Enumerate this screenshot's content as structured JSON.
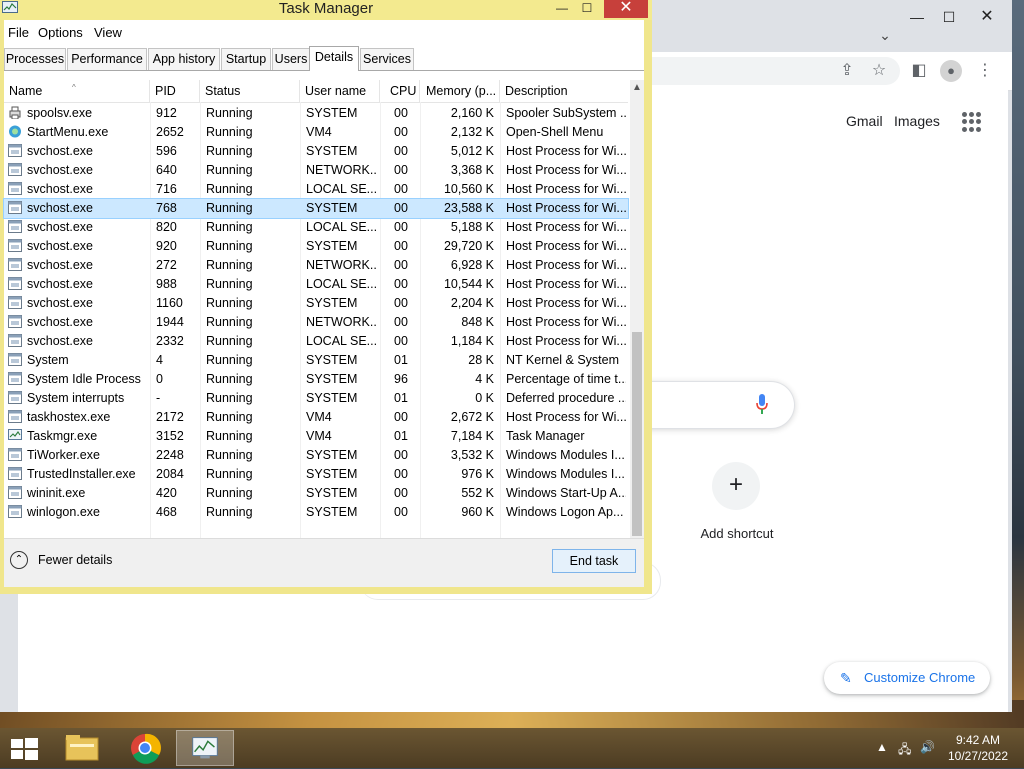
{
  "taskmanager": {
    "title": "Task Manager",
    "menu": [
      "File",
      "Options",
      "View"
    ],
    "tabs": [
      "Processes",
      "Performance",
      "App history",
      "Startup",
      "Users",
      "Details",
      "Services"
    ],
    "active_tab": "Details",
    "columns": [
      "Name",
      "PID",
      "Status",
      "User name",
      "CPU",
      "Memory (p...",
      "Description"
    ],
    "rows": [
      {
        "name": "spoolsv.exe",
        "pid": "912",
        "status": "Running",
        "user": "SYSTEM",
        "cpu": "00",
        "mem": "2,160 K",
        "desc": "Spooler SubSystem ...",
        "icon": "printer-icon"
      },
      {
        "name": "StartMenu.exe",
        "pid": "2652",
        "status": "Running",
        "user": "VM4",
        "cpu": "00",
        "mem": "2,132 K",
        "desc": "Open-Shell Menu",
        "icon": "shell-icon"
      },
      {
        "name": "svchost.exe",
        "pid": "596",
        "status": "Running",
        "user": "SYSTEM",
        "cpu": "00",
        "mem": "5,012 K",
        "desc": "Host Process for Wi...",
        "icon": "process-icon"
      },
      {
        "name": "svchost.exe",
        "pid": "640",
        "status": "Running",
        "user": "NETWORK...",
        "cpu": "00",
        "mem": "3,368 K",
        "desc": "Host Process for Wi...",
        "icon": "process-icon"
      },
      {
        "name": "svchost.exe",
        "pid": "716",
        "status": "Running",
        "user": "LOCAL SE...",
        "cpu": "00",
        "mem": "10,560 K",
        "desc": "Host Process for Wi...",
        "icon": "process-icon"
      },
      {
        "name": "svchost.exe",
        "pid": "768",
        "status": "Running",
        "user": "SYSTEM",
        "cpu": "00",
        "mem": "23,588 K",
        "desc": "Host Process for Wi...",
        "icon": "process-icon",
        "selected": true
      },
      {
        "name": "svchost.exe",
        "pid": "820",
        "status": "Running",
        "user": "LOCAL SE...",
        "cpu": "00",
        "mem": "5,188 K",
        "desc": "Host Process for Wi...",
        "icon": "process-icon"
      },
      {
        "name": "svchost.exe",
        "pid": "920",
        "status": "Running",
        "user": "SYSTEM",
        "cpu": "00",
        "mem": "29,720 K",
        "desc": "Host Process for Wi...",
        "icon": "process-icon"
      },
      {
        "name": "svchost.exe",
        "pid": "272",
        "status": "Running",
        "user": "NETWORK...",
        "cpu": "00",
        "mem": "6,928 K",
        "desc": "Host Process for Wi...",
        "icon": "process-icon"
      },
      {
        "name": "svchost.exe",
        "pid": "988",
        "status": "Running",
        "user": "LOCAL SE...",
        "cpu": "00",
        "mem": "10,544 K",
        "desc": "Host Process for Wi...",
        "icon": "process-icon"
      },
      {
        "name": "svchost.exe",
        "pid": "1160",
        "status": "Running",
        "user": "SYSTEM",
        "cpu": "00",
        "mem": "2,204 K",
        "desc": "Host Process for Wi...",
        "icon": "process-icon"
      },
      {
        "name": "svchost.exe",
        "pid": "1944",
        "status": "Running",
        "user": "NETWORK...",
        "cpu": "00",
        "mem": "848 K",
        "desc": "Host Process for Wi...",
        "icon": "process-icon"
      },
      {
        "name": "svchost.exe",
        "pid": "2332",
        "status": "Running",
        "user": "LOCAL SE...",
        "cpu": "00",
        "mem": "1,184 K",
        "desc": "Host Process for Wi...",
        "icon": "process-icon"
      },
      {
        "name": "System",
        "pid": "4",
        "status": "Running",
        "user": "SYSTEM",
        "cpu": "01",
        "mem": "28 K",
        "desc": "NT Kernel & System",
        "icon": "process-icon"
      },
      {
        "name": "System Idle Process",
        "pid": "0",
        "status": "Running",
        "user": "SYSTEM",
        "cpu": "96",
        "mem": "4 K",
        "desc": "Percentage of time t...",
        "icon": "process-icon"
      },
      {
        "name": "System interrupts",
        "pid": "-",
        "status": "Running",
        "user": "SYSTEM",
        "cpu": "01",
        "mem": "0 K",
        "desc": "Deferred procedure ...",
        "icon": "process-icon"
      },
      {
        "name": "taskhostex.exe",
        "pid": "2172",
        "status": "Running",
        "user": "VM4",
        "cpu": "00",
        "mem": "2,672 K",
        "desc": "Host Process for Wi...",
        "icon": "process-icon"
      },
      {
        "name": "Taskmgr.exe",
        "pid": "3152",
        "status": "Running",
        "user": "VM4",
        "cpu": "01",
        "mem": "7,184 K",
        "desc": "Task Manager",
        "icon": "taskmgr-icon"
      },
      {
        "name": "TiWorker.exe",
        "pid": "2248",
        "status": "Running",
        "user": "SYSTEM",
        "cpu": "00",
        "mem": "3,532 K",
        "desc": "Windows Modules I...",
        "icon": "process-icon"
      },
      {
        "name": "TrustedInstaller.exe",
        "pid": "2084",
        "status": "Running",
        "user": "SYSTEM",
        "cpu": "00",
        "mem": "976 K",
        "desc": "Windows Modules I...",
        "icon": "process-icon"
      },
      {
        "name": "wininit.exe",
        "pid": "420",
        "status": "Running",
        "user": "SYSTEM",
        "cpu": "00",
        "mem": "552 K",
        "desc": "Windows Start-Up A...",
        "icon": "process-icon"
      },
      {
        "name": "winlogon.exe",
        "pid": "468",
        "status": "Running",
        "user": "SYSTEM",
        "cpu": "00",
        "mem": "960 K",
        "desc": "Windows Logon Ap...",
        "icon": "process-icon"
      }
    ],
    "fewer_details": "Fewer details",
    "end_task": "End task"
  },
  "chrome": {
    "gmail": "Gmail",
    "images": "Images",
    "add_shortcut": "Add shortcut",
    "customize": "Customize Chrome"
  },
  "taskbar": {
    "time": "9:42 AM",
    "date": "10/27/2022"
  },
  "colors": {
    "tm_frame": "#f0e68c",
    "selection": "#cce8ff",
    "close_button": "#c7403b",
    "chrome_accent": "#1a73e8"
  }
}
